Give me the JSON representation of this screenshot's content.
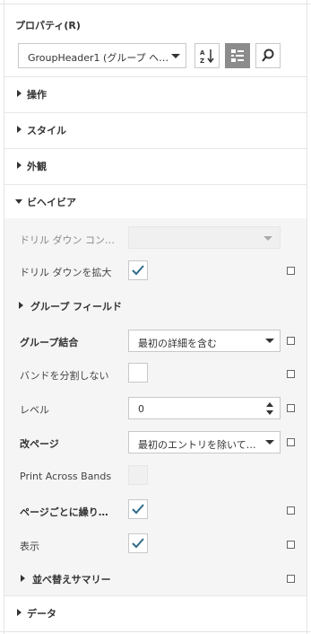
{
  "panel": {
    "title": "プロパティ(R)",
    "object_select": {
      "value": "GroupHeader1 (グループ ヘ…"
    }
  },
  "toolbar": {
    "sort_icon": "sort-az-icon",
    "categorized_icon": "categorized-view-icon",
    "search_icon": "search-icon"
  },
  "sections": {
    "actions": "操作",
    "style": "スタイル",
    "appearance": "外観",
    "behavior": "ビヘイビア",
    "data": "データ"
  },
  "behavior": {
    "drill_down_control": {
      "label": "ドリル ダウン コン…",
      "value": ""
    },
    "drill_down_expanded": {
      "label": "ドリル ダウンを拡大",
      "checked": true
    },
    "group_fields": {
      "label": "グループ フィールド"
    },
    "group_union": {
      "label": "グループ結合",
      "value": "最初の詳細を含む"
    },
    "keep_together": {
      "label": "バンドを分割しない",
      "checked": false
    },
    "level": {
      "label": "レベル",
      "value": "0"
    },
    "page_break": {
      "label": "改ページ",
      "value": "最初のエントリを除いて…"
    },
    "print_across_bands": {
      "label": "Print Across Bands",
      "checked": false
    },
    "repeat_every_page": {
      "label": "ページごとに繰り…",
      "checked": true
    },
    "visible": {
      "label": "表示",
      "checked": true
    },
    "sort_summary": {
      "label": "並べ替えサマリー"
    }
  },
  "colors": {
    "accent_check": "#2e6b8c",
    "active_button": "#8c8c8c",
    "panel_bg": "#ffffff",
    "behavior_bg": "#f5f5f5"
  }
}
